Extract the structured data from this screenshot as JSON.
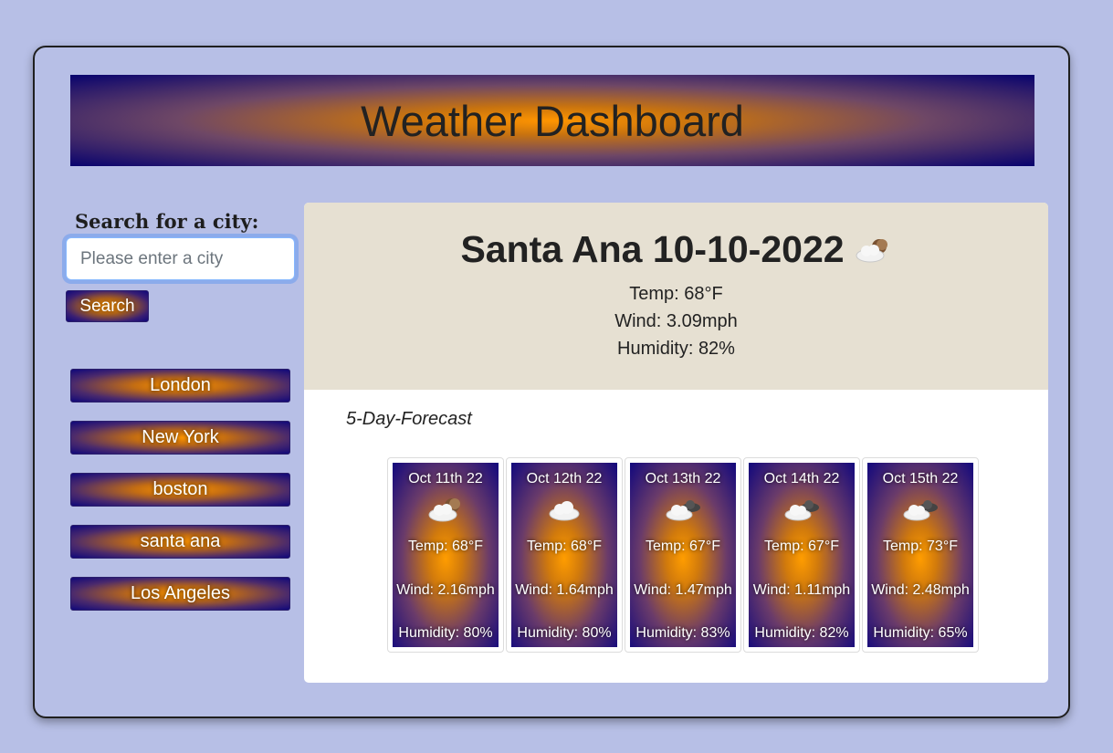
{
  "header": {
    "title": "Weather Dashboard"
  },
  "search": {
    "label": "Search for a city:",
    "placeholder": "Please enter a city",
    "value": "",
    "button_label": "Search"
  },
  "history": [
    "London",
    "New York",
    "boston",
    "santa ana",
    "Los Angeles"
  ],
  "current": {
    "city_date": "Santa Ana 10-10-2022",
    "icon": "partly-cloudy-night-icon",
    "temp": "Temp: 68°F",
    "wind": "Wind: 3.09mph",
    "humidity": "Humidity: 82%"
  },
  "forecast": {
    "title": "5-Day-Forecast",
    "days": [
      {
        "date": "Oct 11th 22",
        "icon": "partly-cloudy-night-icon",
        "temp": "Temp: 68°F",
        "wind": "Wind: 2.16mph",
        "humidity": "Humidity: 80%"
      },
      {
        "date": "Oct 12th 22",
        "icon": "cloud-icon",
        "temp": "Temp: 68°F",
        "wind": "Wind: 1.64mph",
        "humidity": "Humidity: 80%"
      },
      {
        "date": "Oct 13th 22",
        "icon": "broken-clouds-icon",
        "temp": "Temp: 67°F",
        "wind": "Wind: 1.47mph",
        "humidity": "Humidity: 83%"
      },
      {
        "date": "Oct 14th 22",
        "icon": "broken-clouds-icon",
        "temp": "Temp: 67°F",
        "wind": "Wind: 1.11mph",
        "humidity": "Humidity: 82%"
      },
      {
        "date": "Oct 15th 22",
        "icon": "broken-clouds-icon",
        "temp": "Temp: 73°F",
        "wind": "Wind: 2.48mph",
        "humidity": "Humidity: 65%"
      }
    ]
  },
  "colors": {
    "page_bg": "#b7bfe6",
    "accent_orange": "#ff9500",
    "accent_navy": "#07026e",
    "current_panel_bg": "#e6e0d2"
  }
}
